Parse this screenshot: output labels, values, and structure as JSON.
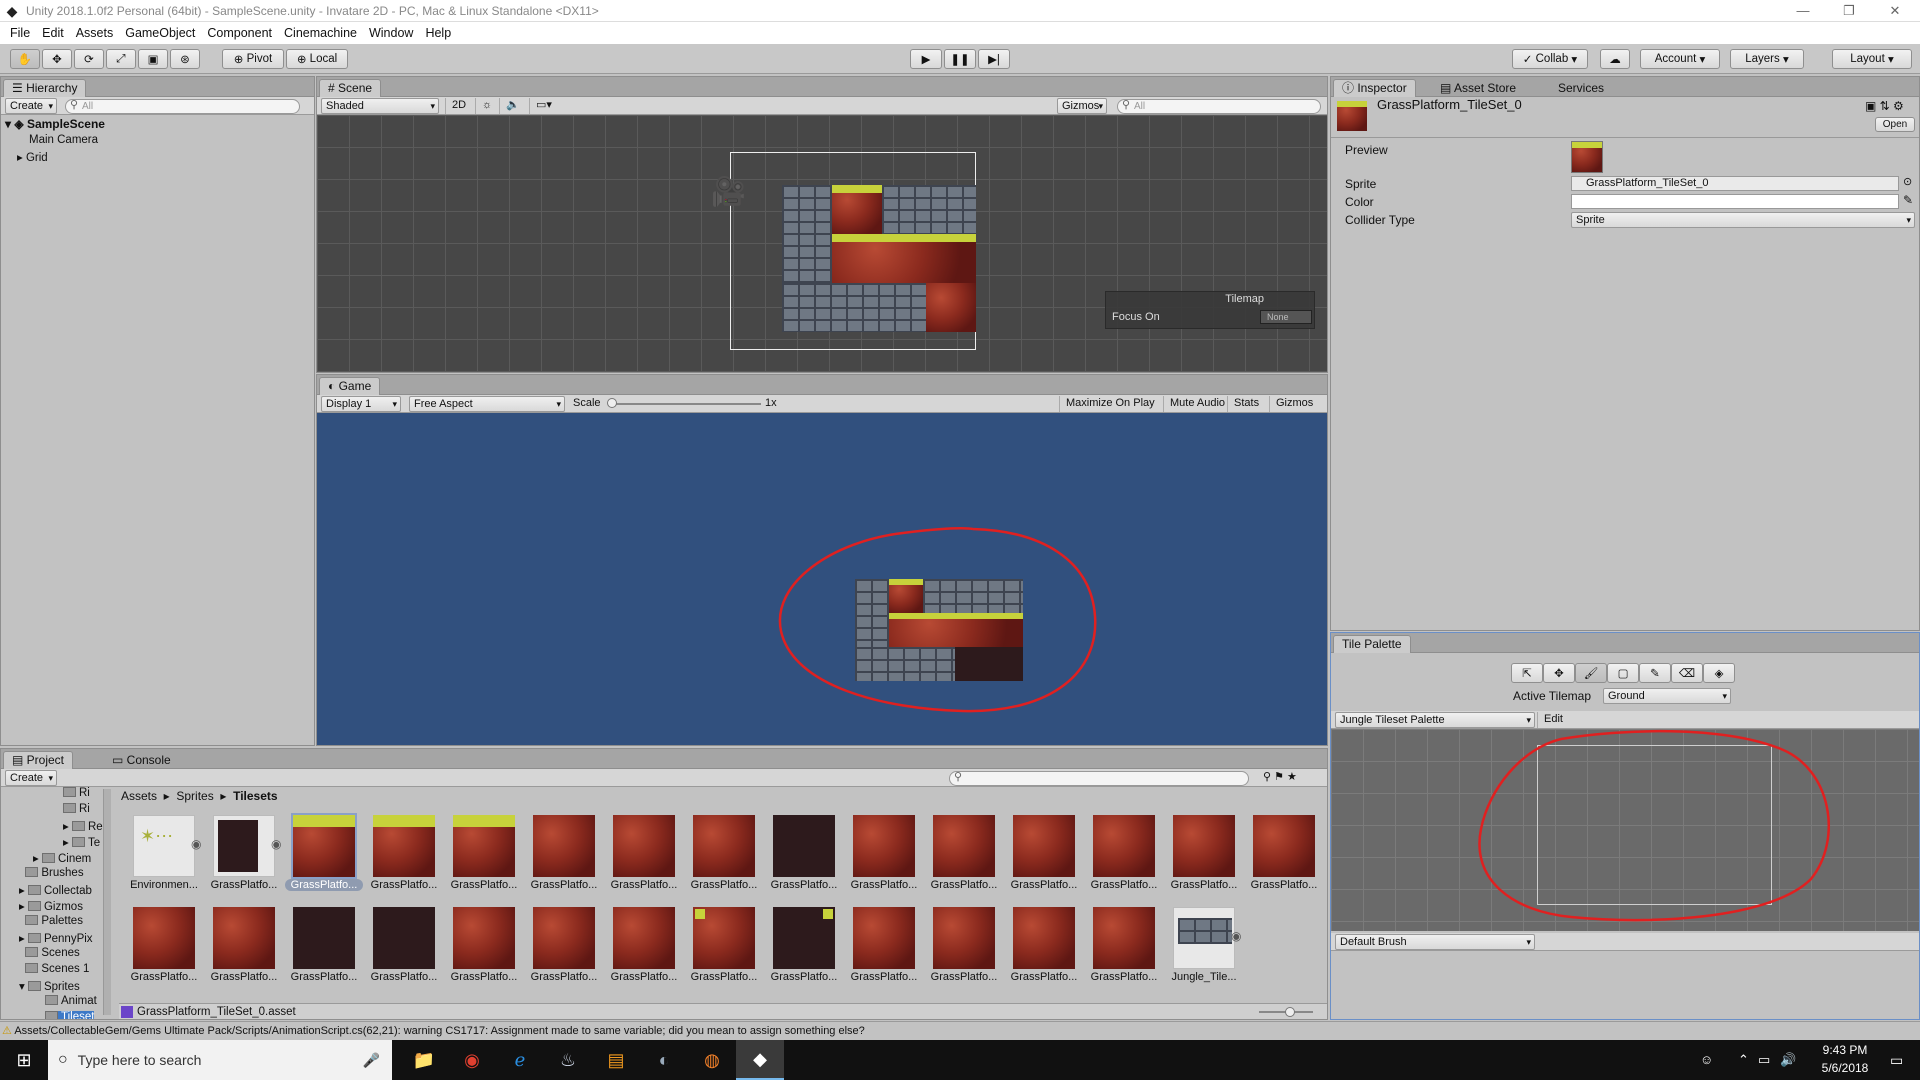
{
  "window": {
    "title": "Unity 2018.1.0f2 Personal (64bit) - SampleScene.unity - Invatare 2D - PC, Mac & Linux Standalone <DX11>"
  },
  "menu": [
    "File",
    "Edit",
    "Assets",
    "GameObject",
    "Component",
    "Cinemachine",
    "Window",
    "Help"
  ],
  "toolbar": {
    "pivot": "Pivot",
    "local": "Local",
    "collab": "Collab",
    "account": "Account",
    "layers": "Layers",
    "layout": "Layout"
  },
  "hierarchy": {
    "tab": "Hierarchy",
    "create": "Create",
    "search_placeholder": "All",
    "scene": "SampleScene",
    "items": [
      "Main Camera",
      "Grid"
    ]
  },
  "scene": {
    "tab": "Scene",
    "shading": "Shaded",
    "mode2d": "2D",
    "gizmos": "Gizmos",
    "search_placeholder": "All",
    "tilemap_title": "Tilemap",
    "focus_label": "Focus On",
    "focus_value": "None"
  },
  "game": {
    "tab": "Game",
    "display": "Display 1",
    "aspect": "Free Aspect",
    "scale_label": "Scale",
    "scale_value": "1x",
    "max_on_play": "Maximize On Play",
    "mute": "Mute Audio",
    "stats": "Stats",
    "gizmos": "Gizmos"
  },
  "inspector": {
    "tabs": [
      "Inspector",
      "Asset Store",
      "Services"
    ],
    "object_name": "GrassPlatform_TileSet_0",
    "open": "Open",
    "preview_label": "Preview",
    "sprite_label": "Sprite",
    "sprite_value": "GrassPlatform_TileSet_0",
    "color_label": "Color",
    "collider_label": "Collider Type",
    "collider_value": "Sprite"
  },
  "tile_palette": {
    "tab": "Tile Palette",
    "active_tilemap_label": "Active Tilemap",
    "active_tilemap_value": "Ground",
    "palette": "Jungle Tileset Palette",
    "edit": "Edit",
    "brush": "Default Brush"
  },
  "project": {
    "tab": "Project",
    "console_tab": "Console",
    "create": "Create",
    "breadcrumb": [
      "Assets",
      "Sprites",
      "Tilesets"
    ],
    "tree": [
      "Ri",
      "Ri",
      "Re",
      "Te",
      "Cinem",
      "Brushes",
      "Collectab",
      "Gizmos",
      "Palettes",
      "PennyPix",
      "Scenes",
      "Scenes 1",
      "Sprites",
      "Animat",
      "Tileset"
    ],
    "row1": [
      "Environmen...",
      "GrassPlatfo...",
      "GrassPlatfo...",
      "GrassPlatfo...",
      "GrassPlatfo...",
      "GrassPlatfo...",
      "GrassPlatfo...",
      "GrassPlatfo...",
      "GrassPlatfo...",
      "GrassPlatfo...",
      "GrassPlatfo...",
      "GrassPlatfo...",
      "GrassPlatfo...",
      "GrassPlatfo...",
      "GrassPlatfo..."
    ],
    "row2": [
      "GrassPlatfo...",
      "GrassPlatfo...",
      "GrassPlatfo...",
      "GrassPlatfo...",
      "GrassPlatfo...",
      "GrassPlatfo...",
      "GrassPlatfo...",
      "GrassPlatfo...",
      "GrassPlatfo...",
      "GrassPlatfo...",
      "GrassPlatfo...",
      "GrassPlatfo...",
      "GrassPlatfo...",
      "Jungle_Tile..."
    ],
    "selected_asset": "GrassPlatform_TileSet_0.asset"
  },
  "status": {
    "message": "Assets/CollectableGem/Gems Ultimate Pack/Scripts/AnimationScript.cs(62,21): warning CS1717: Assignment made to same variable; did you mean to assign something else?"
  },
  "taskbar": {
    "search_placeholder": "Type here to search",
    "time": "9:43 PM",
    "date": "5/6/2018"
  }
}
